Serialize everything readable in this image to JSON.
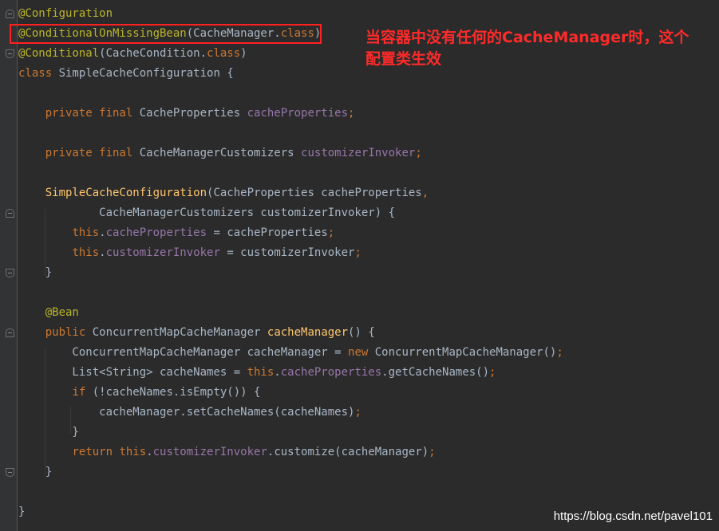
{
  "editor": {
    "lines": [
      [
        {
          "t": "@Configuration",
          "c": "ann"
        }
      ],
      [
        {
          "t": "@ConditionalOnMissingBean",
          "c": "ann"
        },
        {
          "t": "(CacheManager.",
          "c": "txt"
        },
        {
          "t": "class",
          "c": "kw"
        },
        {
          "t": ")",
          "c": "txt"
        }
      ],
      [
        {
          "t": "@Conditional",
          "c": "ann"
        },
        {
          "t": "(CacheCondition.",
          "c": "txt"
        },
        {
          "t": "class",
          "c": "kw"
        },
        {
          "t": ")",
          "c": "txt"
        }
      ],
      [
        {
          "t": "class ",
          "c": "kw"
        },
        {
          "t": "SimpleCacheConfiguration {",
          "c": "txt"
        }
      ],
      [],
      [
        {
          "t": "    ",
          "c": "txt"
        },
        {
          "t": "private final ",
          "c": "kw"
        },
        {
          "t": "CacheProperties ",
          "c": "txt"
        },
        {
          "t": "cacheProperties",
          "c": "fld"
        },
        {
          "t": ";",
          "c": "kw"
        }
      ],
      [],
      [
        {
          "t": "    ",
          "c": "txt"
        },
        {
          "t": "private final ",
          "c": "kw"
        },
        {
          "t": "CacheManagerCustomizers ",
          "c": "txt"
        },
        {
          "t": "customizerInvoker",
          "c": "fld"
        },
        {
          "t": ";",
          "c": "kw"
        }
      ],
      [],
      [
        {
          "t": "    ",
          "c": "txt"
        },
        {
          "t": "SimpleCacheConfiguration",
          "c": "mth"
        },
        {
          "t": "(CacheProperties cacheProperties",
          "c": "txt"
        },
        {
          "t": ",",
          "c": "kw"
        }
      ],
      [
        {
          "t": "            CacheManagerCustomizers customizerInvoker) {",
          "c": "txt"
        }
      ],
      [
        {
          "t": "        ",
          "c": "txt"
        },
        {
          "t": "this",
          "c": "kw"
        },
        {
          "t": ".",
          "c": "txt"
        },
        {
          "t": "cacheProperties",
          "c": "fld"
        },
        {
          "t": " = cacheProperties",
          "c": "txt"
        },
        {
          "t": ";",
          "c": "kw"
        }
      ],
      [
        {
          "t": "        ",
          "c": "txt"
        },
        {
          "t": "this",
          "c": "kw"
        },
        {
          "t": ".",
          "c": "txt"
        },
        {
          "t": "customizerInvoker",
          "c": "fld"
        },
        {
          "t": " = customizerInvoker",
          "c": "txt"
        },
        {
          "t": ";",
          "c": "kw"
        }
      ],
      [
        {
          "t": "    }",
          "c": "txt"
        }
      ],
      [],
      [
        {
          "t": "    ",
          "c": "txt"
        },
        {
          "t": "@Bean",
          "c": "ann"
        }
      ],
      [
        {
          "t": "    ",
          "c": "txt"
        },
        {
          "t": "public ",
          "c": "kw"
        },
        {
          "t": "ConcurrentMapCacheManager ",
          "c": "txt"
        },
        {
          "t": "cacheManager",
          "c": "mth"
        },
        {
          "t": "() {",
          "c": "txt"
        }
      ],
      [
        {
          "t": "        ConcurrentMapCacheManager cacheManager = ",
          "c": "txt"
        },
        {
          "t": "new ",
          "c": "kw"
        },
        {
          "t": "ConcurrentMapCacheManager()",
          "c": "txt"
        },
        {
          "t": ";",
          "c": "kw"
        }
      ],
      [
        {
          "t": "        List<String> cacheNames = ",
          "c": "txt"
        },
        {
          "t": "this",
          "c": "kw"
        },
        {
          "t": ".",
          "c": "txt"
        },
        {
          "t": "cacheProperties",
          "c": "fld"
        },
        {
          "t": ".getCacheNames()",
          "c": "txt"
        },
        {
          "t": ";",
          "c": "kw"
        }
      ],
      [
        {
          "t": "        ",
          "c": "txt"
        },
        {
          "t": "if ",
          "c": "kw"
        },
        {
          "t": "(!cacheNames.isEmpty()) {",
          "c": "txt"
        }
      ],
      [
        {
          "t": "            cacheManager.setCacheNames(cacheNames)",
          "c": "txt"
        },
        {
          "t": ";",
          "c": "kw"
        }
      ],
      [
        {
          "t": "        }",
          "c": "txt"
        }
      ],
      [
        {
          "t": "        ",
          "c": "txt"
        },
        {
          "t": "return this",
          "c": "kw"
        },
        {
          "t": ".",
          "c": "txt"
        },
        {
          "t": "customizerInvoker",
          "c": "fld"
        },
        {
          "t": ".customize(cacheManager)",
          "c": "txt"
        },
        {
          "t": ";",
          "c": "kw"
        }
      ],
      [
        {
          "t": "    }",
          "c": "txt"
        }
      ],
      [],
      [
        {
          "t": "}",
          "c": "txt"
        }
      ]
    ]
  },
  "annotation_note": "当容器中没有任何的CacheManager时，这个配置类生效",
  "watermark": "https://blog.csdn.net/pavel101",
  "colors": {
    "background": "#2b2b2b",
    "annotation": "#bbb529",
    "keyword": "#cc7832",
    "field": "#9876aa",
    "method": "#ffc66d",
    "text": "#a9b7c6",
    "highlight_border": "#ff2020",
    "note": "#ff2a2a"
  }
}
